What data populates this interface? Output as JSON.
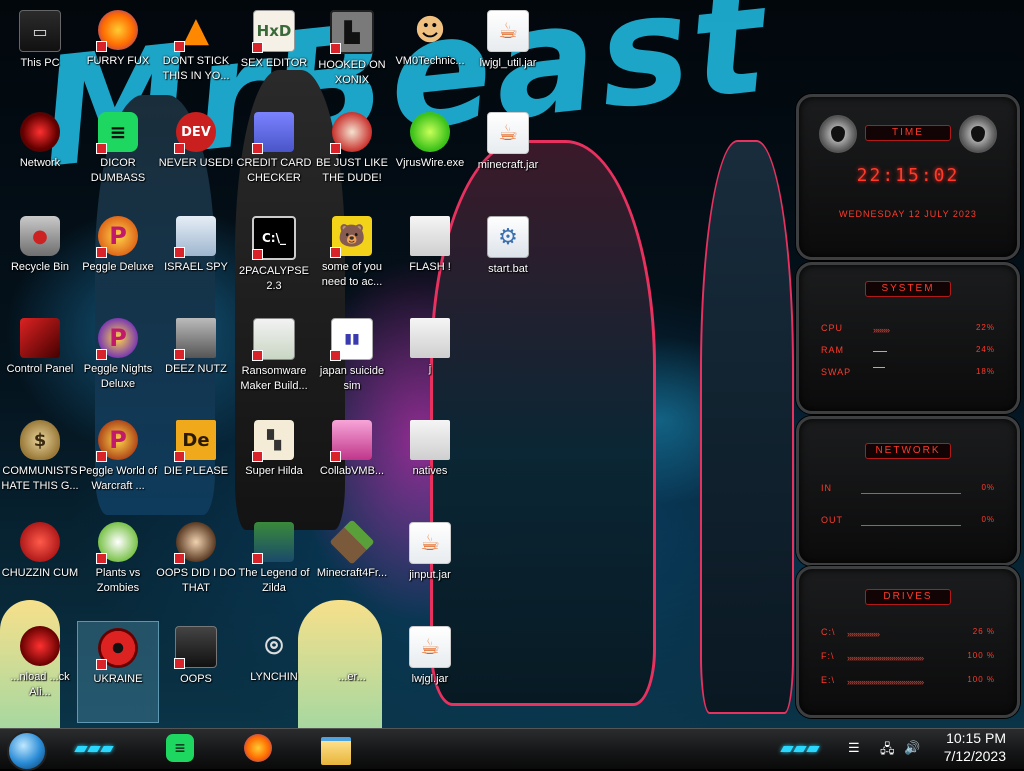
{
  "wallpaper": {
    "graffiti_text": "MrBeast"
  },
  "desktop_icons": [
    {
      "id": "this-pc",
      "label": "This PC"
    },
    {
      "id": "furry-fux",
      "label": "FURRY FUX"
    },
    {
      "id": "dont-stick",
      "label": "DONT STICK THIS IN YO..."
    },
    {
      "id": "sex-editor",
      "label": "SEX EDITOR"
    },
    {
      "id": "hooked-on-xonix",
      "label": "HOOKED ON XONIX"
    },
    {
      "id": "vm0technic",
      "label": "VM0Technic..."
    },
    {
      "id": "lwjgl-util",
      "label": "lwjgl_util.jar"
    },
    {
      "id": "network",
      "label": "Network"
    },
    {
      "id": "dicor",
      "label": "DICOR DUMBASS"
    },
    {
      "id": "never-used",
      "label": "NEVER USED!"
    },
    {
      "id": "credit-card",
      "label": "CREDIT CARD CHECKER"
    },
    {
      "id": "be-just-like",
      "label": "BE JUST LIKE THE DUDE!"
    },
    {
      "id": "vjruswire",
      "label": "VjrusWire.exe"
    },
    {
      "id": "minecraft-jar",
      "label": "minecraft.jar"
    },
    {
      "id": "recycle-bin",
      "label": "Recycle Bin"
    },
    {
      "id": "peggle-deluxe",
      "label": "Peggle Deluxe"
    },
    {
      "id": "israel-spy",
      "label": "ISRAEL SPY"
    },
    {
      "id": "2pacalypse",
      "label": "2PACALYPSE 2.3"
    },
    {
      "id": "some-of-you",
      "label": "some of you need to ac..."
    },
    {
      "id": "flash",
      "label": "FLASH !"
    },
    {
      "id": "start-bat",
      "label": "start.bat"
    },
    {
      "id": "control-panel",
      "label": "Control Panel"
    },
    {
      "id": "peggle-nights",
      "label": "Peggle Nights Deluxe"
    },
    {
      "id": "deez-nutz",
      "label": "DEEZ NUTZ"
    },
    {
      "id": "ransomware",
      "label": "Ransomware Maker Build..."
    },
    {
      "id": "japan-suicide",
      "label": "japan suicide sim"
    },
    {
      "id": "j-folder",
      "label": "j"
    },
    {
      "id": "communists",
      "label": "COMMUNISTS HATE THIS G..."
    },
    {
      "id": "peggle-world",
      "label": "Peggle World of Warcraft ..."
    },
    {
      "id": "die-please",
      "label": "DIE PLEASE"
    },
    {
      "id": "super-hilda",
      "label": "Super Hilda"
    },
    {
      "id": "collabvmb",
      "label": "CollabVMB..."
    },
    {
      "id": "natives",
      "label": "natives"
    },
    {
      "id": "chuzzin",
      "label": "CHUZZIN CUM"
    },
    {
      "id": "plants-zombies",
      "label": "Plants vs Zombies"
    },
    {
      "id": "oops-did",
      "label": "OOPS DID I DO THAT"
    },
    {
      "id": "legend-zilda",
      "label": "The Legend of Zilda"
    },
    {
      "id": "minecraft4r",
      "label": "Minecraft4Fr..."
    },
    {
      "id": "jinput",
      "label": "jinput.jar"
    },
    {
      "id": "download",
      "label": "...nload ...ck Ali..."
    },
    {
      "id": "ukraine",
      "label": "UKRAINE"
    },
    {
      "id": "oops",
      "label": "OOPS"
    },
    {
      "id": "lynchin",
      "label": "LYNCHIN"
    },
    {
      "id": "minecraft-ver",
      "label": "...er..."
    },
    {
      "id": "lwjgl",
      "label": "lwjgl.jar"
    }
  ],
  "widgets": {
    "time": {
      "title": "TIME",
      "clock": "22:15:02",
      "date": "WEDNESDAY 12 JULY 2023"
    },
    "system": {
      "title": "SYSTEM",
      "rows": [
        {
          "label": "CPU",
          "value": "22%",
          "level": 0.22
        },
        {
          "label": "RAM",
          "value": "24%",
          "level": 0.24
        },
        {
          "label": "SWAP",
          "value": "18%",
          "level": 0.18
        }
      ]
    },
    "network": {
      "title": "NETWORK",
      "rows": [
        {
          "label": "IN",
          "value": "0%"
        },
        {
          "label": "OUT",
          "value": "0%"
        }
      ]
    },
    "drives": {
      "title": "DRIVES",
      "rows": [
        {
          "label": "C:\\",
          "value": "26 %",
          "level": 0.26
        },
        {
          "label": "F:\\",
          "value": "100 %",
          "level": 1.0
        },
        {
          "label": "E:\\",
          "value": "100 %",
          "level": 1.0
        }
      ]
    }
  },
  "taskbar": {
    "pinned": [
      "spotify-icon",
      "firefox-icon",
      "file-explorer-icon"
    ],
    "clock_time": "10:15 PM",
    "clock_date": "7/12/2023"
  },
  "colors": {
    "accent_red": "#ff3a2a",
    "accent_cyan": "#2ad8ff"
  }
}
